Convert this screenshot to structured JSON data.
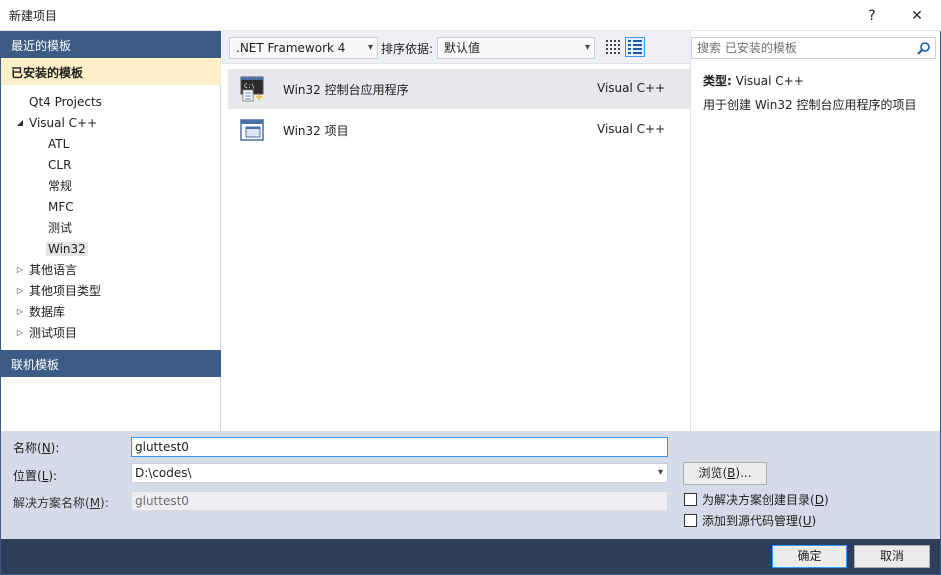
{
  "window": {
    "title": "新建项目",
    "help": "?",
    "close": "✕"
  },
  "sidebar": {
    "recent": "最近的模板",
    "installed": "已安装的模板",
    "online": "联机模板",
    "tree": [
      {
        "label": "Qt4 Projects",
        "level": 0,
        "arrow": ""
      },
      {
        "label": "Visual C++",
        "level": 0,
        "arrow": "◢"
      },
      {
        "label": "ATL",
        "level": 1,
        "arrow": ""
      },
      {
        "label": "CLR",
        "level": 1,
        "arrow": ""
      },
      {
        "label": "常规",
        "level": 1,
        "arrow": ""
      },
      {
        "label": "MFC",
        "level": 1,
        "arrow": ""
      },
      {
        "label": "测试",
        "level": 1,
        "arrow": ""
      },
      {
        "label": "Win32",
        "level": 1,
        "arrow": "",
        "selected": true
      },
      {
        "label": "其他语言",
        "level": 0,
        "arrow": "▷"
      },
      {
        "label": "其他项目类型",
        "level": 0,
        "arrow": "▷"
      },
      {
        "label": "数据库",
        "level": 0,
        "arrow": "▷"
      },
      {
        "label": "测试项目",
        "level": 0,
        "arrow": "▷"
      }
    ]
  },
  "toolbar": {
    "framework": ".NET Framework 4",
    "sort_label": "排序依据:",
    "sort_value": "默认值"
  },
  "templates": [
    {
      "name": "Win32 控制台应用程序",
      "lang": "Visual C++",
      "selected": true
    },
    {
      "name": "Win32 项目",
      "lang": "Visual C++",
      "selected": false
    }
  ],
  "search": {
    "placeholder": "搜索 已安装的模板"
  },
  "details": {
    "type_label": "类型:",
    "type_value": "Visual C++",
    "description": "用于创建 Win32 控制台应用程序的项目"
  },
  "form": {
    "name_label_pre": "名称(",
    "name_label_key": "N",
    "name_label_post": "):",
    "name_value": "gluttest0",
    "location_label_pre": "位置(",
    "location_label_key": "L",
    "location_label_post": "):",
    "location_value": "D:\\codes\\",
    "solution_label_pre": "解决方案名称(",
    "solution_label_key": "M",
    "solution_label_post": "):",
    "solution_value": "gluttest0",
    "browse_pre": "浏览(",
    "browse_key": "B",
    "browse_post": ")...",
    "check1_pre": "为解决方案创建目录(",
    "check1_key": "D",
    "check1_post": ")",
    "check2_pre": "添加到源代码管理(",
    "check2_key": "U",
    "check2_post": ")"
  },
  "footer": {
    "ok": "确定",
    "cancel": "取消"
  }
}
